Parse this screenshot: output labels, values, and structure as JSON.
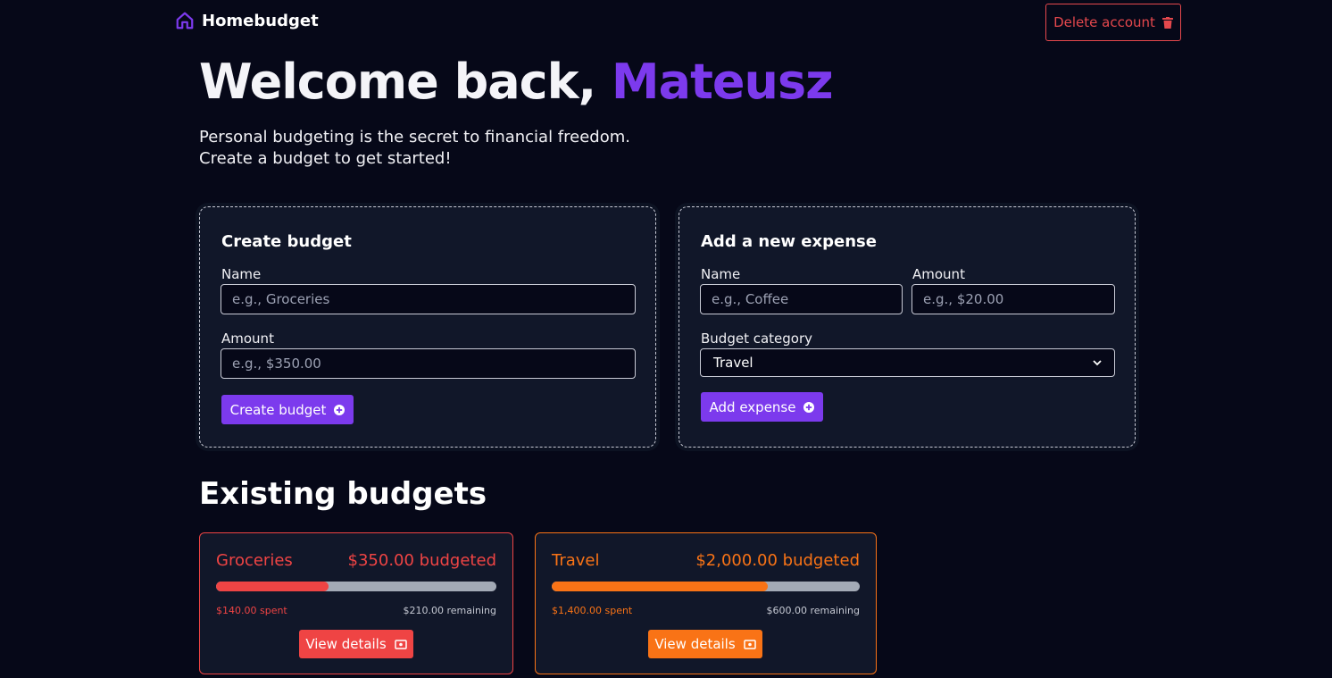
{
  "nav": {
    "brand": "Homebudget",
    "logo_icon": "home-icon",
    "delete_label": "Delete account",
    "delete_icon": "trash-icon"
  },
  "hero": {
    "greeting": "Welcome back, ",
    "username": "Mateusz",
    "line1": "Personal budgeting is the secret to financial freedom.",
    "line2": "Create a budget to get started!"
  },
  "create_budget": {
    "title": "Create budget",
    "name_label": "Name",
    "name_placeholder": "e.g., Groceries",
    "amount_label": "Amount",
    "amount_placeholder": "e.g., $350.00",
    "submit_label": "Create budget",
    "submit_icon": "plus-circle-icon"
  },
  "add_expense": {
    "title": "Add a new expense",
    "name_label": "Name",
    "name_placeholder": "e.g., Coffee",
    "amount_label": "Amount",
    "amount_placeholder": "e.g., $20.00",
    "category_label": "Budget category",
    "category_value": "Travel",
    "submit_label": "Add expense",
    "submit_icon": "plus-circle-icon"
  },
  "existing": {
    "title": "Existing budgets",
    "budgets": [
      {
        "name": "Groceries",
        "budgeted": "$350.00 budgeted",
        "spent": "$140.00 spent",
        "remaining": "$210.00 remaining",
        "progress": 0.4,
        "color": "#ef4444",
        "button_label": "View details",
        "button_icon": "cash-icon"
      },
      {
        "name": "Travel",
        "budgeted": "$2,000.00 budgeted",
        "spent": "$1,400.00 spent",
        "remaining": "$600.00 remaining",
        "progress": 0.7,
        "color": "#f97316",
        "button_label": "View details",
        "button_icon": "cash-icon"
      }
    ]
  },
  "colors": {
    "background": "#060818",
    "accent": "#7c3aed",
    "danger": "#e5484d",
    "card": "#111729"
  }
}
